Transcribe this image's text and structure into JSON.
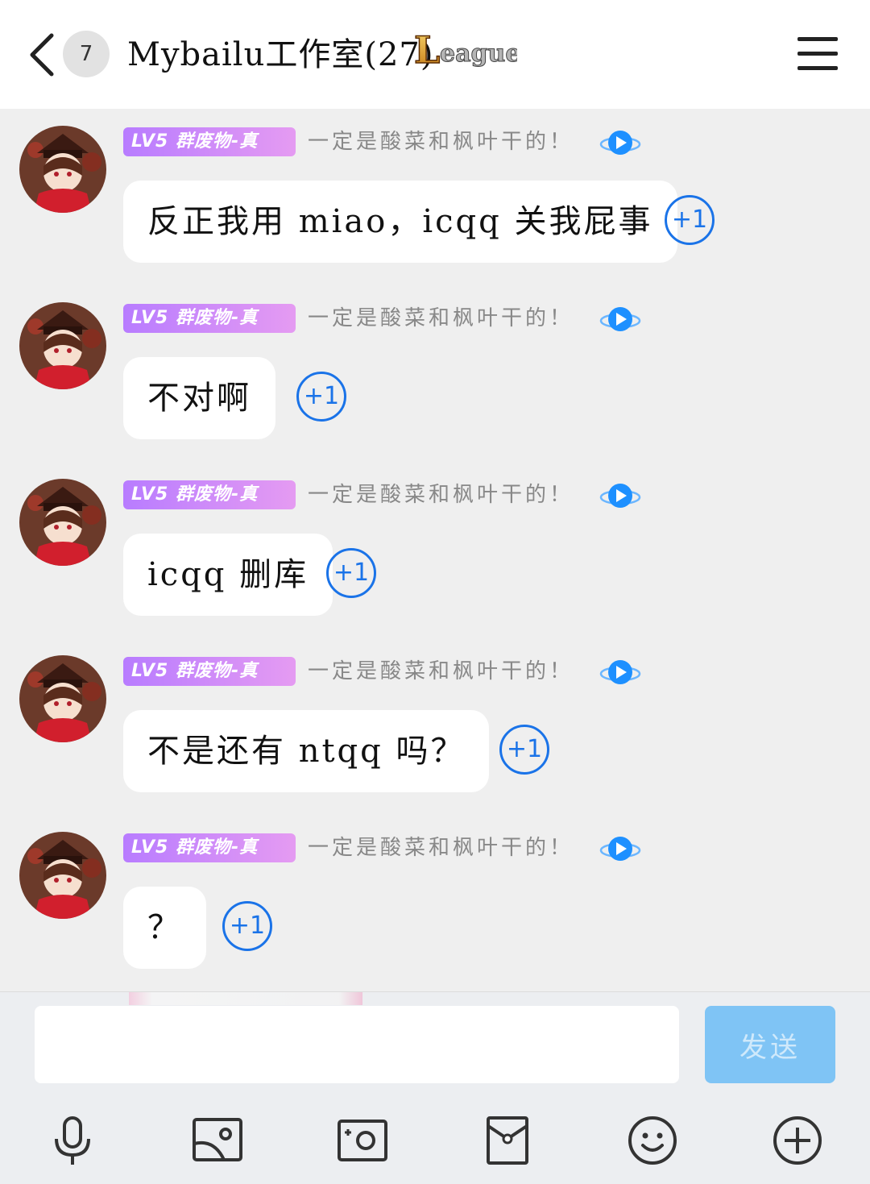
{
  "header": {
    "unread_count": "7",
    "title": "Mybailu工作室(27)",
    "badge_text": "League"
  },
  "messages": [
    {
      "level": "LV5 群废物-真",
      "signature": "一定是酸菜和枫叶干的！",
      "text": "反正我用 miao，icqq 关我屁事",
      "plus_one": "+1"
    },
    {
      "level": "LV5 群废物-真",
      "signature": "一定是酸菜和枫叶干的！",
      "text": "不对啊",
      "plus_one": "+1"
    },
    {
      "level": "LV5 群废物-真",
      "signature": "一定是酸菜和枫叶干的！",
      "text": "icqq 删库",
      "plus_one": "+1"
    },
    {
      "level": "LV5 群废物-真",
      "signature": "一定是酸菜和枫叶干的！",
      "text": "不是还有 ntqq 吗？",
      "plus_one": "+1"
    },
    {
      "level": "LV5 群废物-真",
      "signature": "一定是酸菜和枫叶干的！",
      "text": "？",
      "plus_one": "+1"
    }
  ],
  "input": {
    "value": "",
    "send_label": "发送"
  },
  "toolbar": {
    "icons": [
      "microphone-icon",
      "image-icon",
      "camera-icon",
      "red-packet-icon",
      "emoji-icon",
      "plus-icon"
    ]
  },
  "colors": {
    "accent": "#1a73e8",
    "send_button": "#7fc4f5",
    "level_badge_start": "#b87cff",
    "level_badge_end": "#e59bf2",
    "background": "#efefef"
  }
}
